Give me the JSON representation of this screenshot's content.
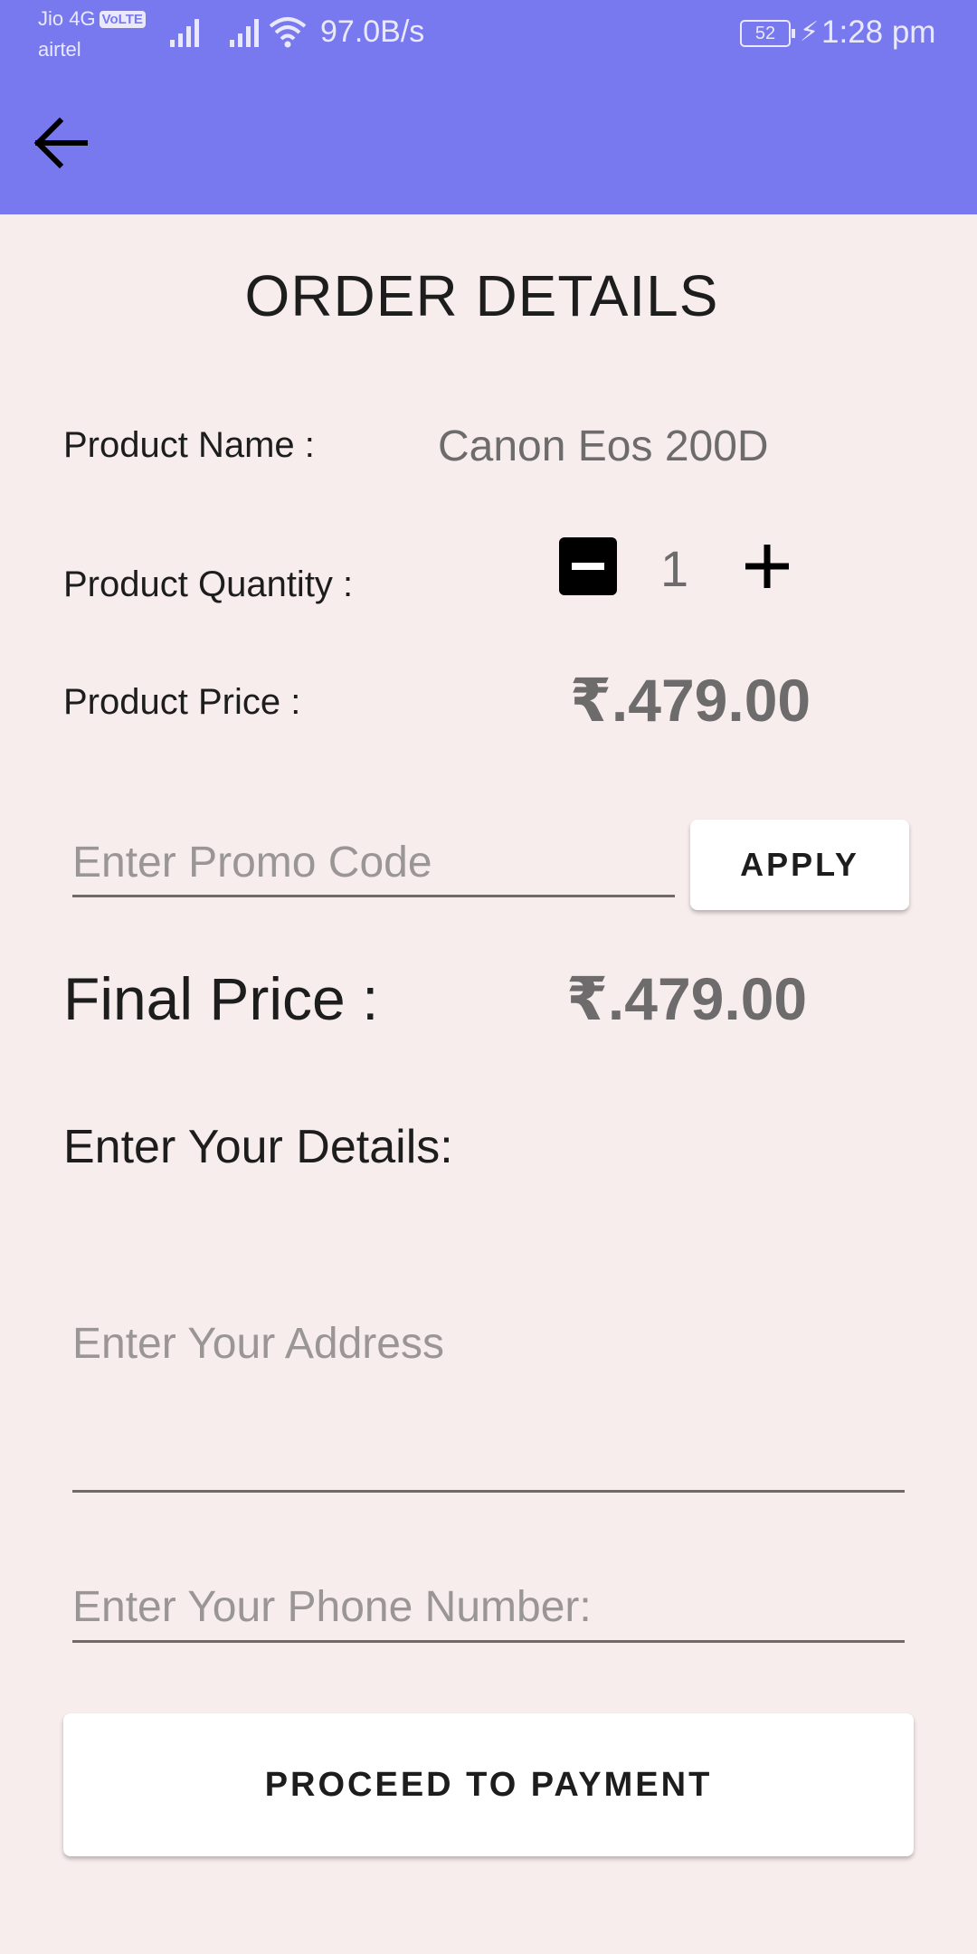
{
  "status_bar": {
    "carrier_primary": "Jio 4G",
    "volte_badge": "VoLTE",
    "carrier_secondary": "airtel",
    "network_speed": "97.0B/s",
    "battery_level": "52",
    "time": "1:28 pm",
    "icons": [
      "signal-icon",
      "signal-icon",
      "wifi-icon",
      "battery-icon",
      "charging-icon"
    ]
  },
  "app_bar": {
    "back_icon": "arrow-left-icon",
    "color": "#7879ef"
  },
  "order": {
    "title": "ORDER DETAILS",
    "product_name_label": "Product Name :",
    "product_name": "Canon Eos 200D",
    "quantity_label": "Product Quantity :",
    "quantity": "1",
    "price_label": "Product Price :",
    "price": "₹.479.00",
    "promo_placeholder": "Enter Promo Code",
    "apply_label": "APPLY",
    "final_price_label": "Final Price :",
    "final_price": "₹.479.00",
    "details_heading": "Enter Your Details:",
    "address_placeholder": "Enter Your Address",
    "phone_placeholder": "Enter Your Phone Number:",
    "proceed_label": "PROCEED TO PAYMENT"
  },
  "colors": {
    "background": "#f7eded",
    "accent": "#7879ef",
    "muted_text": "#6d6b6b"
  }
}
